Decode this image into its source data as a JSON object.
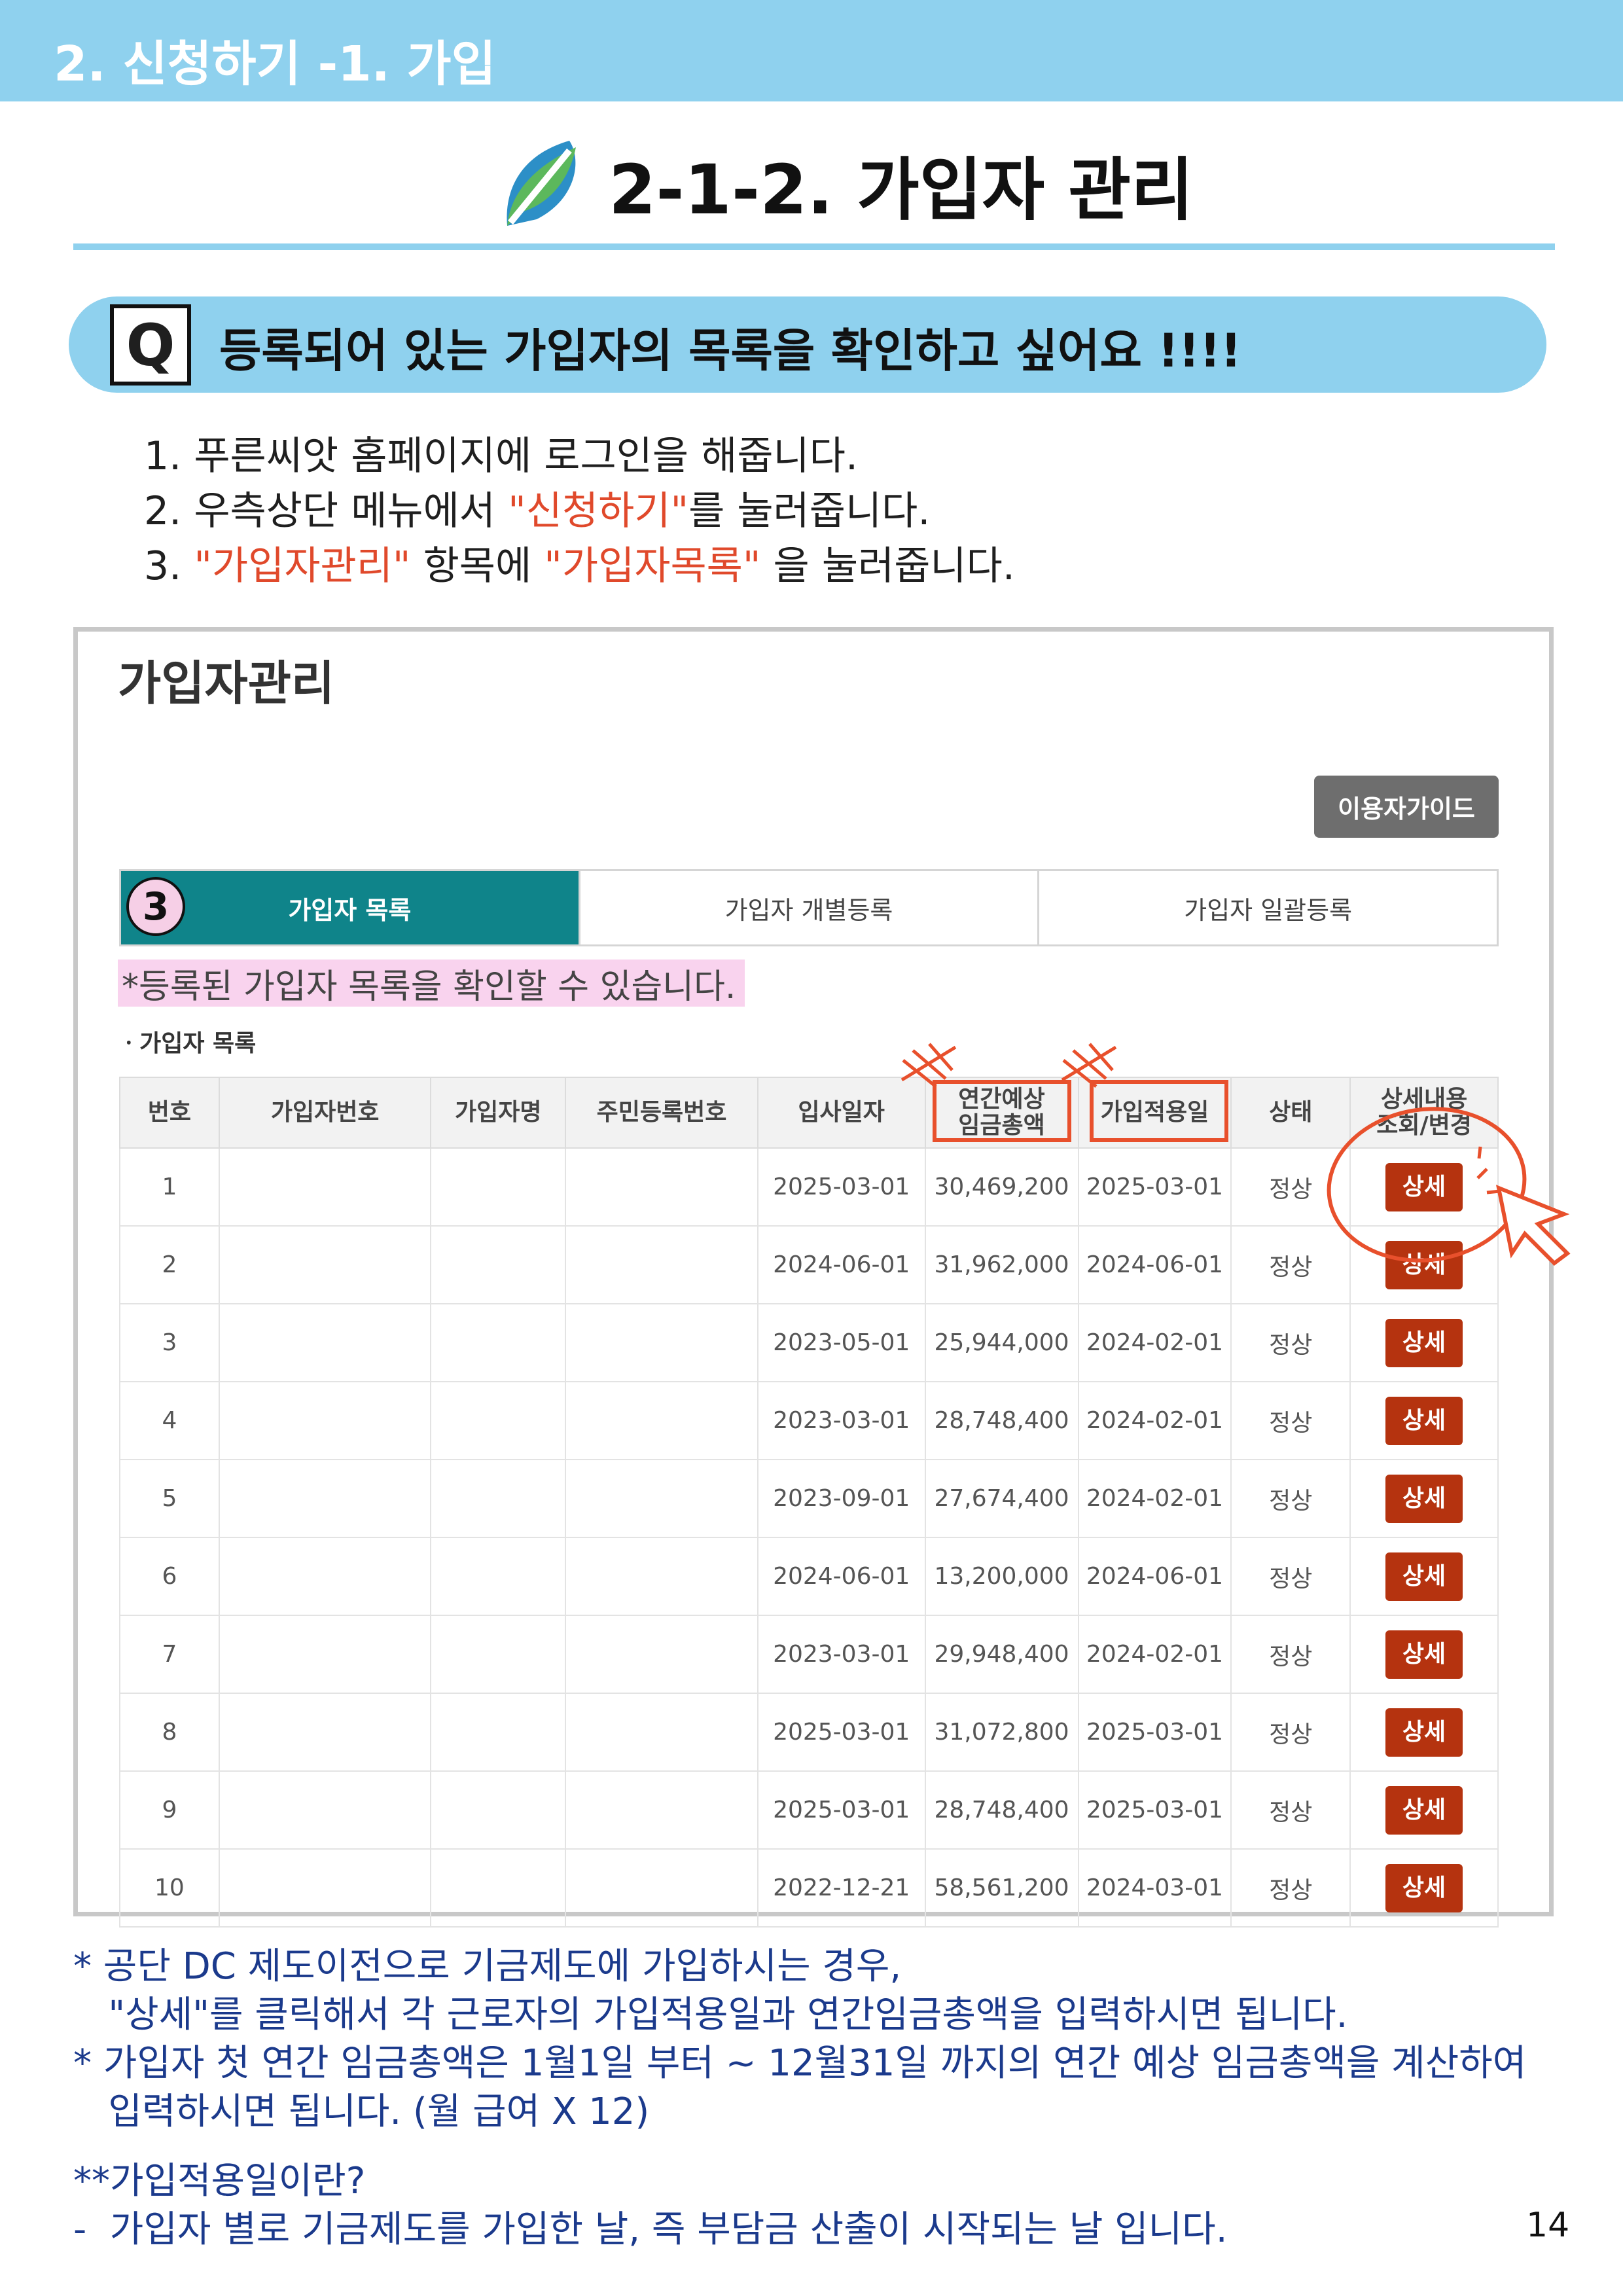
{
  "banner": {
    "text": "2. 신청하기 -1. 가입"
  },
  "section": {
    "title": "2-1-2. 가입자 관리"
  },
  "question": {
    "badge": "Q",
    "text": "등록되어 있는 가입자의 목록을 확인하고 싶어요 !!!!"
  },
  "steps": [
    {
      "num": "1.",
      "before": " 푸른씨앗 홈페이지에 로그인을 해줍니다.",
      "red1": "",
      "mid": "",
      "red2": "",
      "after": ""
    },
    {
      "num": "2.",
      "before": "  우측상단 메뉴에서 ",
      "red1": "\"신청하기\"",
      "mid": "를 눌러줍니다.",
      "red2": "",
      "after": ""
    },
    {
      "num": "3.",
      "before": "  ",
      "red1": "\"가입자관리\"",
      "mid": " 항목에 ",
      "red2": "\"가입자목록\"",
      "after": " 을 눌러줍니다."
    }
  ],
  "screenshot": {
    "title": "가입자관리",
    "guide_button": "이용자가이드",
    "step_badge": "3",
    "tabs": [
      "가입자 목록",
      "가입자 개별등록",
      "가입자 일괄등록"
    ],
    "hint": "*등록된 가입자 목록을 확인할 수 있습니다.",
    "list_label": "ㆍ가입자 목록",
    "columns": [
      "번호",
      "가입자번호",
      "가입자명",
      "주민등록번호",
      "입사일자",
      "연간예상\n임금총액",
      "가입적용일",
      "상태",
      "상세내용\n조회/변경"
    ],
    "rows": [
      {
        "no": "1",
        "member_no": "",
        "name": "",
        "rrn": "",
        "hire_date": "2025-03-01",
        "annual_wage": "30,469,200",
        "apply_date": "2025-03-01",
        "status": "정상",
        "action": "상세"
      },
      {
        "no": "2",
        "member_no": "",
        "name": "",
        "rrn": "",
        "hire_date": "2024-06-01",
        "annual_wage": "31,962,000",
        "apply_date": "2024-06-01",
        "status": "정상",
        "action": "상세"
      },
      {
        "no": "3",
        "member_no": "",
        "name": "",
        "rrn": "",
        "hire_date": "2023-05-01",
        "annual_wage": "25,944,000",
        "apply_date": "2024-02-01",
        "status": "정상",
        "action": "상세"
      },
      {
        "no": "4",
        "member_no": "",
        "name": "",
        "rrn": "",
        "hire_date": "2023-03-01",
        "annual_wage": "28,748,400",
        "apply_date": "2024-02-01",
        "status": "정상",
        "action": "상세"
      },
      {
        "no": "5",
        "member_no": "",
        "name": "",
        "rrn": "",
        "hire_date": "2023-09-01",
        "annual_wage": "27,674,400",
        "apply_date": "2024-02-01",
        "status": "정상",
        "action": "상세"
      },
      {
        "no": "6",
        "member_no": "",
        "name": "",
        "rrn": "",
        "hire_date": "2024-06-01",
        "annual_wage": "13,200,000",
        "apply_date": "2024-06-01",
        "status": "정상",
        "action": "상세"
      },
      {
        "no": "7",
        "member_no": "",
        "name": "",
        "rrn": "",
        "hire_date": "2023-03-01",
        "annual_wage": "29,948,400",
        "apply_date": "2024-02-01",
        "status": "정상",
        "action": "상세"
      },
      {
        "no": "8",
        "member_no": "",
        "name": "",
        "rrn": "",
        "hire_date": "2025-03-01",
        "annual_wage": "31,072,800",
        "apply_date": "2025-03-01",
        "status": "정상",
        "action": "상세"
      },
      {
        "no": "9",
        "member_no": "",
        "name": "",
        "rrn": "",
        "hire_date": "2025-03-01",
        "annual_wage": "28,748,400",
        "apply_date": "2025-03-01",
        "status": "정상",
        "action": "상세"
      },
      {
        "no": "10",
        "member_no": "",
        "name": "",
        "rrn": "",
        "hire_date": "2022-12-21",
        "annual_wage": "58,561,200",
        "apply_date": "2024-03-01",
        "status": "정상",
        "action": "상세"
      }
    ]
  },
  "notes": [
    "* 공단 DC 제도이전으로 기금제도에 가입하시는 경우,",
    "   \"상세\"를 클릭해서 각 근로자의 가입적용일과 연간임금총액을 입력하시면 됩니다.",
    "* 가입자 첫 연간 임금총액은 1월1일 부터 ~ 12월31일 까지의 연간 예상 임금총액을 계산하여",
    "   입력하시면 됩니다. (월 급여 X 12)"
  ],
  "definition": {
    "heading": "**가입적용일이란?",
    "text": "-  가입자 별로 기금제도를 가입한 날, 즉 부담금 산출이 시작되는 날 입니다."
  },
  "page_number": "14",
  "colors": {
    "banner": "#8fd1ee",
    "tab_active": "#0f848a",
    "detail_button": "#b5330f",
    "highlight": "#e8502c",
    "note_text": "#1b3a8c"
  }
}
